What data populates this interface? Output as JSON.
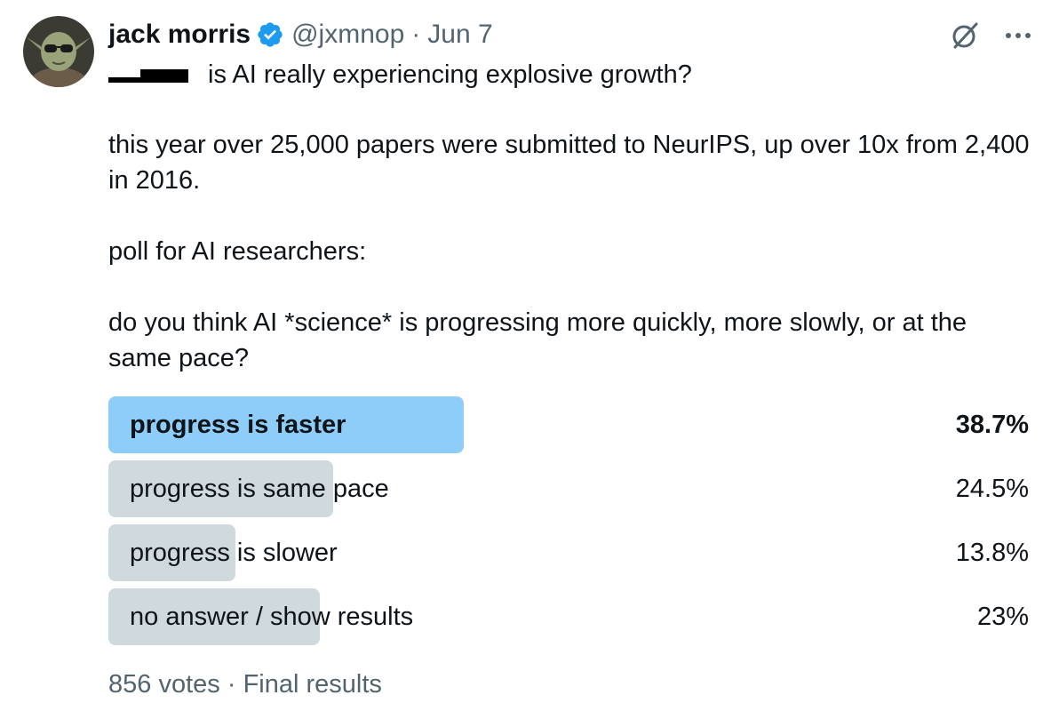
{
  "tweet": {
    "author_name": "jack morris",
    "handle": "@jxmnop",
    "separator": "·",
    "date": "Jun 7",
    "quote_text": "is AI really experiencing explosive growth?",
    "paragraphs": [
      "this year over 25,000 papers were submitted to NeurIPS, up over 10x from 2,400 in 2016.",
      "poll for AI researchers:",
      "do you think AI *science* is progressing more quickly, more slowly, or at the same pace?"
    ]
  },
  "poll": {
    "options": [
      {
        "label": "progress is faster",
        "percent_text": "38.7%",
        "percent": 38.7,
        "winner": true
      },
      {
        "label": "progress is same pace",
        "percent_text": "24.5%",
        "percent": 24.5,
        "winner": false
      },
      {
        "label": "progress is slower",
        "percent_text": "13.8%",
        "percent": 13.8,
        "winner": false
      },
      {
        "label": "no answer / show results",
        "percent_text": "23%",
        "percent": 23,
        "winner": false
      }
    ],
    "votes": "856 votes",
    "separator": "·",
    "status": "Final results"
  },
  "icons": {
    "verified": "verified-badge-icon",
    "grok": "grok-icon",
    "more": "more-options-icon"
  },
  "colors": {
    "winner_bar": "#8ecdf8",
    "other_bar": "#cfd9de",
    "verified": "#1d9bf0",
    "secondary_text": "#536471"
  }
}
